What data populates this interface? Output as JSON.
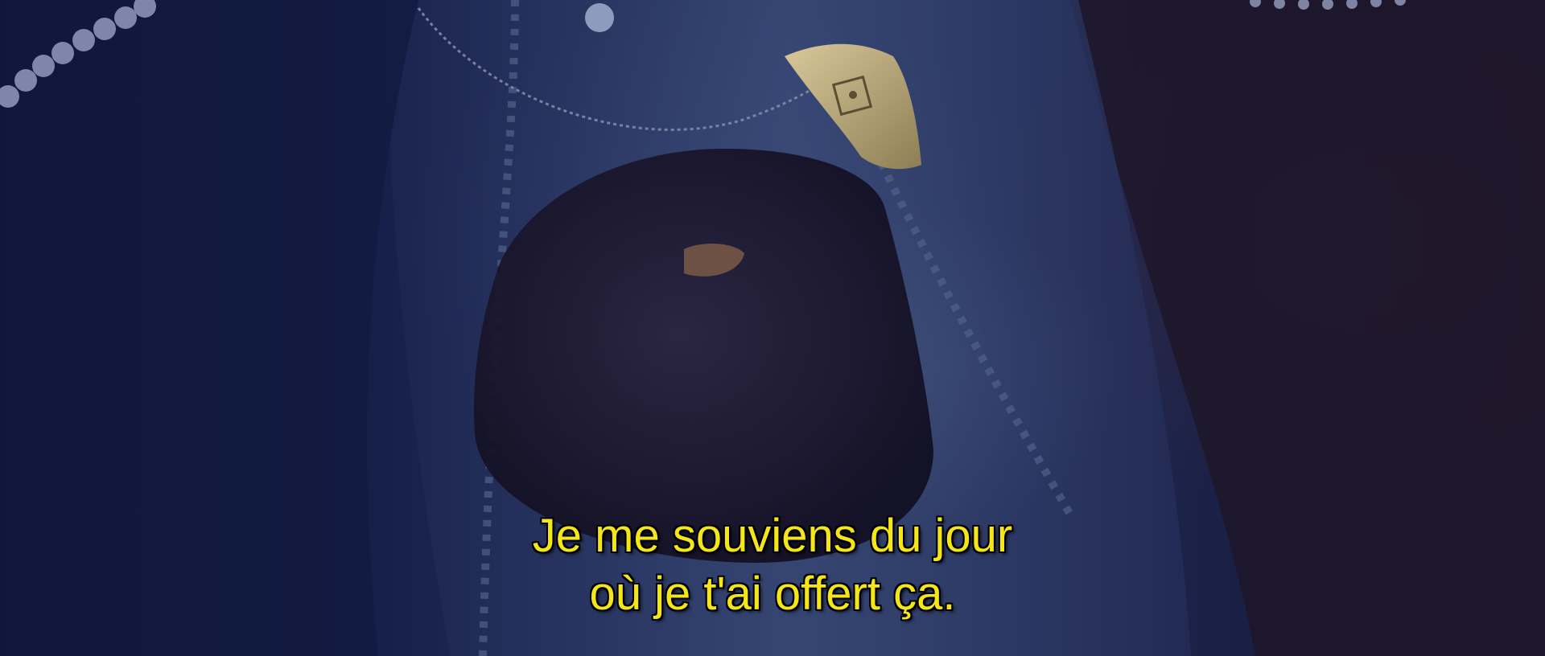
{
  "subtitle": {
    "line1": "Je me souviens du jour",
    "line2": "où je t'ai offert ça."
  },
  "scene": {
    "description_icon": "hand-holding-pendant-icon",
    "colors": {
      "background_dark": "#0b0f26",
      "fabric": "#2b3862",
      "subtitle_text": "#f5e61a",
      "subtitle_outline": "#000000",
      "pendant": "#b9a67a"
    }
  }
}
